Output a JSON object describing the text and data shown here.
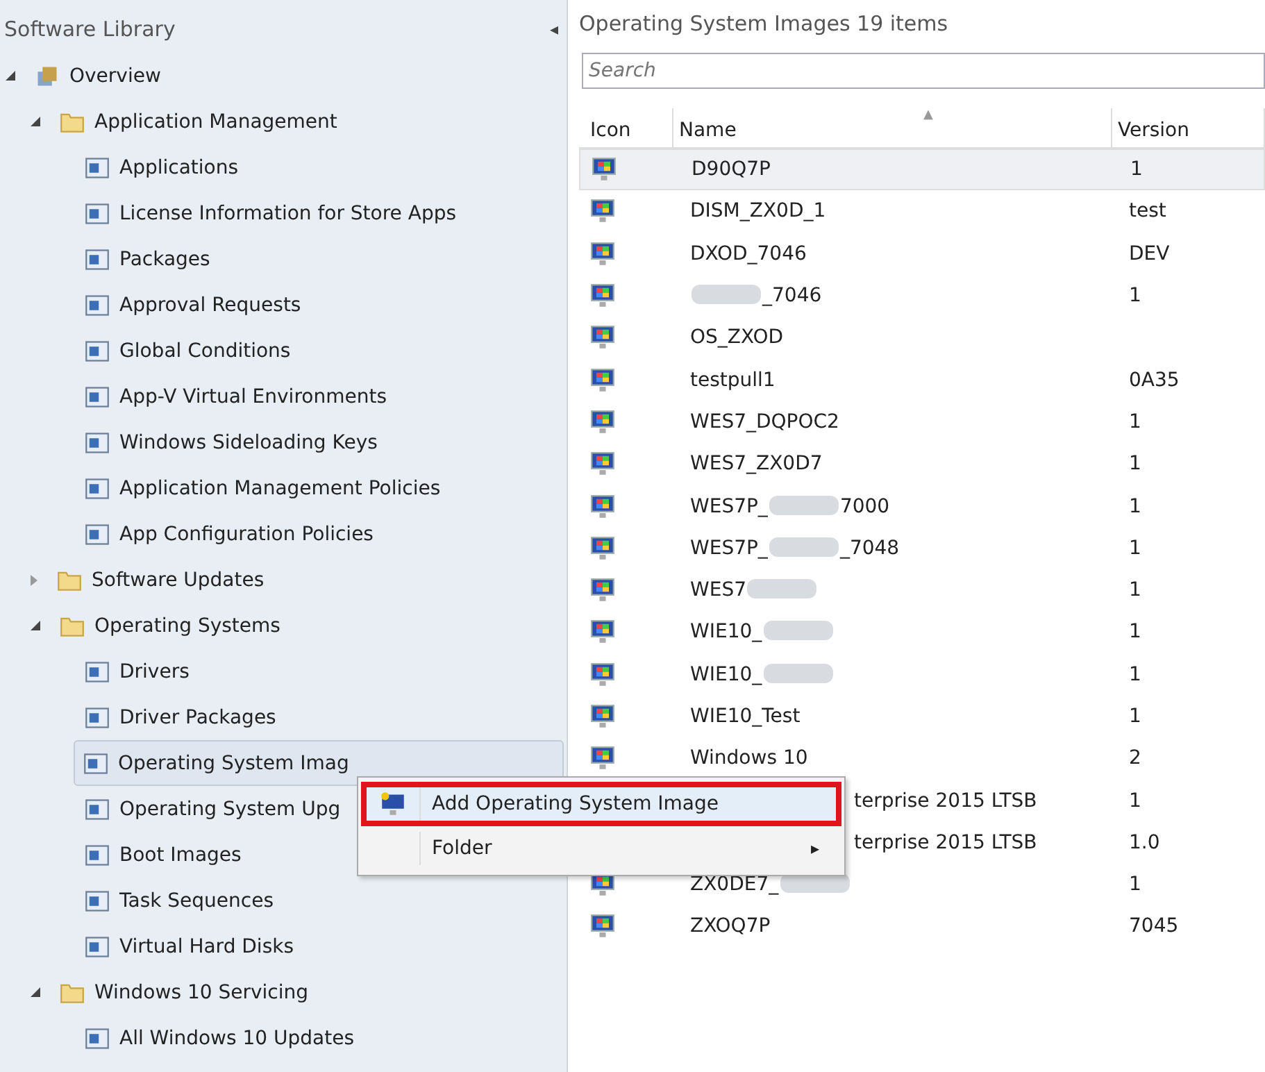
{
  "sidebar": {
    "title": "Software Library",
    "collapse_glyph": "◂",
    "tree": [
      {
        "label": "Overview",
        "expanded": true,
        "selected": false,
        "children": [
          {
            "label": "Application Management",
            "expanded": true,
            "selected": false,
            "children": [
              {
                "label": "Applications",
                "selected": false
              },
              {
                "label": "License Information for Store Apps",
                "selected": false
              },
              {
                "label": "Packages",
                "selected": false
              },
              {
                "label": "Approval Requests",
                "selected": false
              },
              {
                "label": "Global Conditions",
                "selected": false
              },
              {
                "label": "App-V Virtual Environments",
                "selected": false
              },
              {
                "label": "Windows Sideloading Keys",
                "selected": false
              },
              {
                "label": "Application Management Policies",
                "selected": false
              },
              {
                "label": "App Configuration Policies",
                "selected": false
              }
            ]
          },
          {
            "label": "Software Updates",
            "expanded": false,
            "selected": false
          },
          {
            "label": "Operating Systems",
            "expanded": true,
            "selected": false,
            "children": [
              {
                "label": "Drivers",
                "selected": false
              },
              {
                "label": "Driver Packages",
                "selected": false
              },
              {
                "label": "Operating System Imag",
                "selected": true
              },
              {
                "label": "Operating System Upg",
                "selected": false
              },
              {
                "label": "Boot Images",
                "selected": false
              },
              {
                "label": "Task Sequences",
                "selected": false
              },
              {
                "label": "Virtual Hard Disks",
                "selected": false
              }
            ]
          },
          {
            "label": "Windows 10 Servicing",
            "expanded": true,
            "selected": false,
            "children": [
              {
                "label": "All Windows 10 Updates",
                "selected": false
              }
            ]
          }
        ]
      }
    ]
  },
  "content": {
    "title": "Operating System Images 19 items",
    "search": {
      "placeholder": "Search"
    },
    "table": {
      "columns": [
        "Icon",
        "Name",
        "Version"
      ],
      "sort_glyph": "▲",
      "rows": [
        {
          "name": "D90Q7P",
          "version": "1",
          "selected": true
        },
        {
          "name": "DISM_ZX0D_1",
          "version": "test",
          "selected": false
        },
        {
          "name": "DXOD_7046",
          "version": "DEV",
          "selected": false
        },
        {
          "name_parts": [
            {
              "kind": "blur"
            },
            {
              "kind": "text",
              "text": "_7046"
            }
          ],
          "version": "1",
          "selected": false
        },
        {
          "name": "OS_ZXOD",
          "version": "",
          "selected": false
        },
        {
          "name": "testpull1",
          "version": "0A35",
          "selected": false
        },
        {
          "name": "WES7_DQPOC2",
          "version": "1",
          "selected": false
        },
        {
          "name": "WES7_ZX0D7",
          "version": "1",
          "selected": false
        },
        {
          "name_parts": [
            {
              "kind": "text",
              "text": "WES7P_"
            },
            {
              "kind": "blur"
            },
            {
              "kind": "text",
              "text": "7000"
            }
          ],
          "version": "1",
          "selected": false
        },
        {
          "name_parts": [
            {
              "kind": "text",
              "text": "WES7P_"
            },
            {
              "kind": "blur"
            },
            {
              "kind": "text",
              "text": "_7048"
            }
          ],
          "version": "1",
          "selected": false
        },
        {
          "name_parts": [
            {
              "kind": "text",
              "text": "WES7"
            },
            {
              "kind": "blur"
            }
          ],
          "version": "1",
          "selected": false
        },
        {
          "name_parts": [
            {
              "kind": "text",
              "text": "WIE10_"
            },
            {
              "kind": "blur"
            }
          ],
          "version": "1",
          "selected": false
        },
        {
          "name_parts": [
            {
              "kind": "text",
              "text": "WIE10_"
            },
            {
              "kind": "blur"
            }
          ],
          "version": "1",
          "selected": false
        },
        {
          "name": "WIE10_Test",
          "version": "1",
          "selected": false
        },
        {
          "name": "Windows 10",
          "version": "2",
          "selected": false
        },
        {
          "name": "terprise 2015 LTSB",
          "covered": true,
          "version": "1",
          "selected": false
        },
        {
          "name": "terprise 2015 LTSB",
          "covered": true,
          "version": "1.0",
          "selected": false
        },
        {
          "name_parts": [
            {
              "kind": "text",
              "text": "ZX0DE7_"
            },
            {
              "kind": "blur"
            }
          ],
          "version": "1",
          "selected": false
        },
        {
          "name": "ZXOQ7P",
          "version": "7045",
          "selected": false
        }
      ]
    }
  },
  "context_menu": {
    "items": [
      {
        "label": "Add Operating System Image",
        "highlighted": true,
        "submenu": false,
        "marked": true
      },
      {
        "label": "Folder",
        "highlighted": false,
        "submenu": true,
        "submenu_glyph": "▸",
        "marked": false
      }
    ]
  }
}
